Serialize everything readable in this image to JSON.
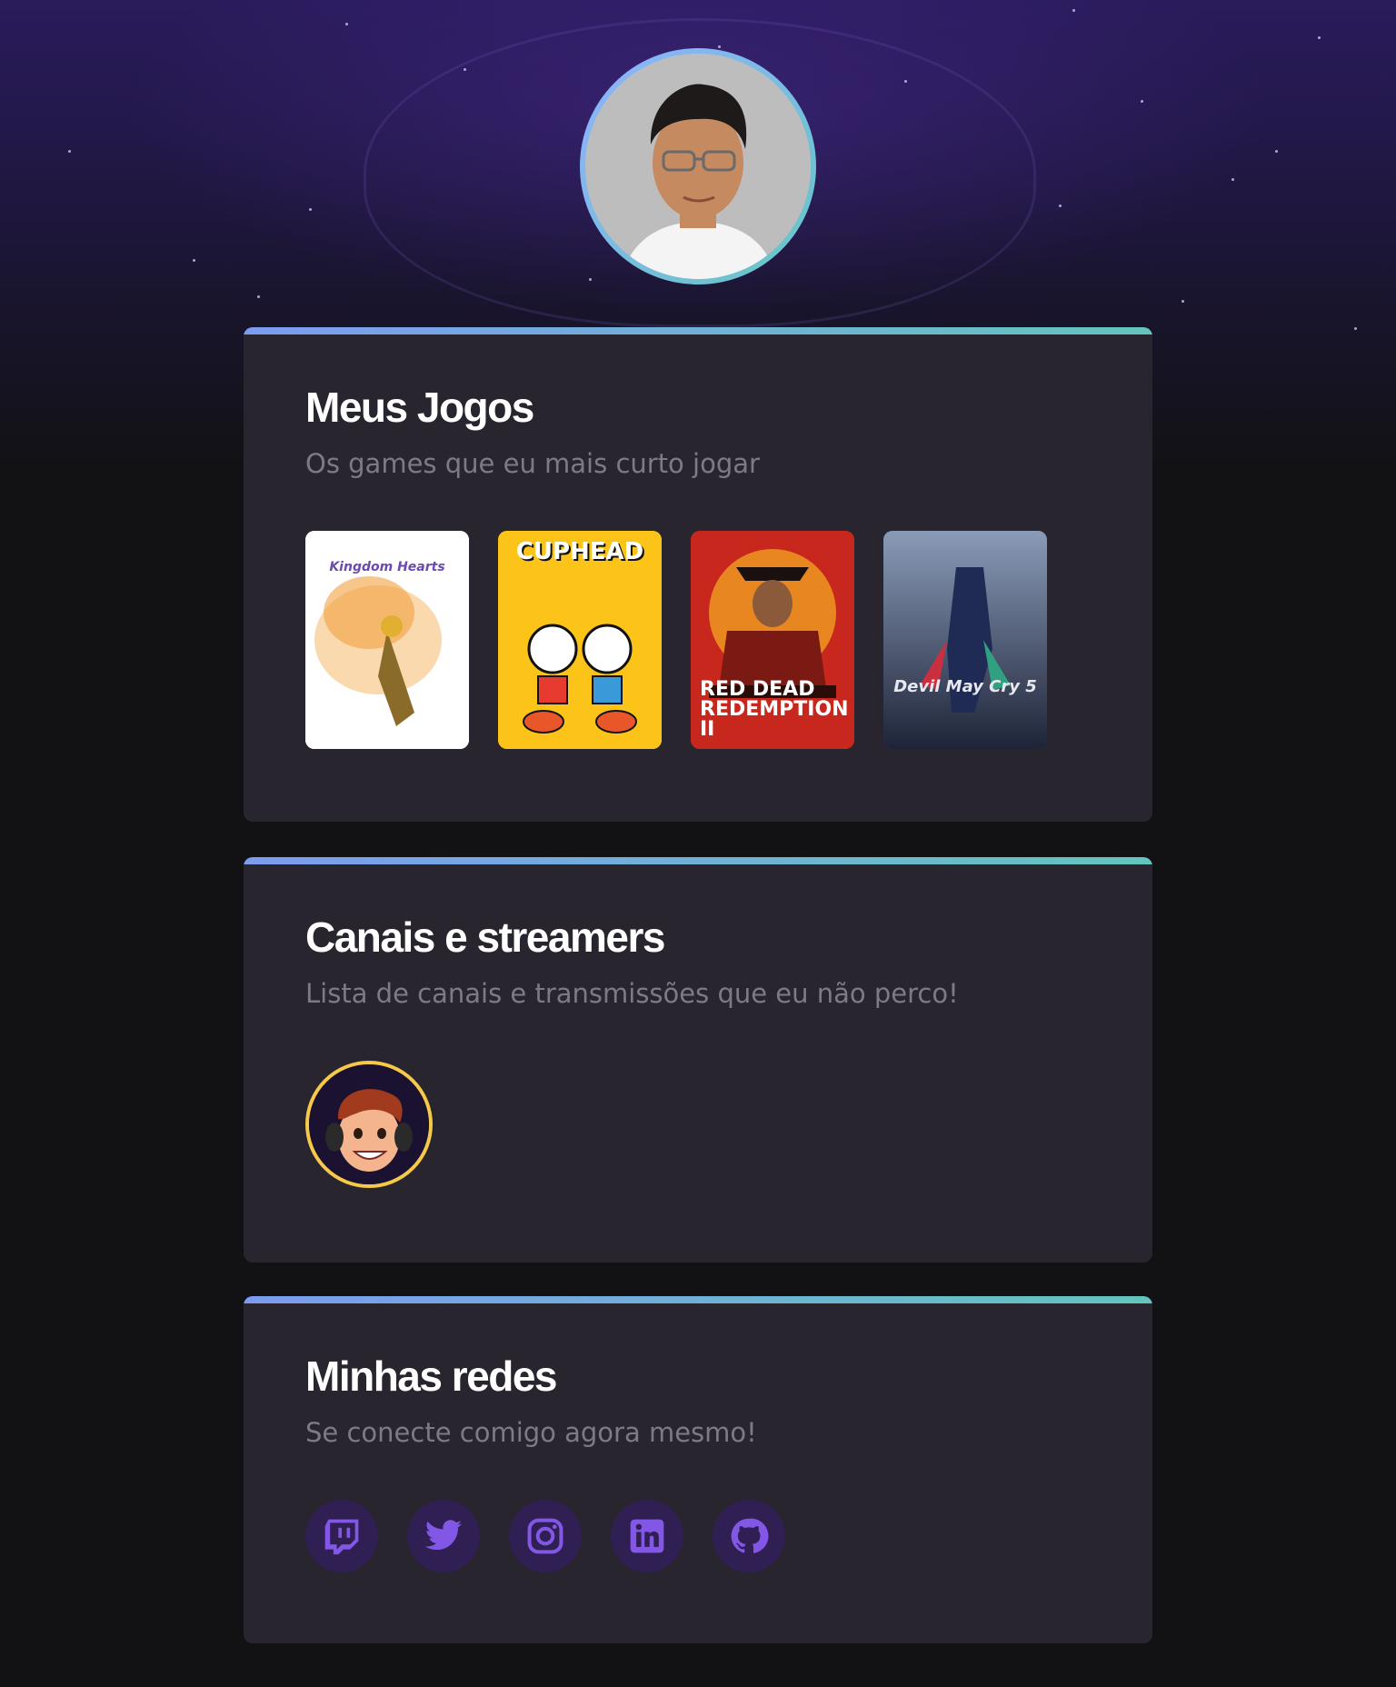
{
  "profile": {
    "avatar_icon": "profile-photo"
  },
  "games_section": {
    "title": "Meus Jogos",
    "subtitle": "Os games que eu mais curto jogar",
    "games": [
      {
        "name": "Kingdom Hearts",
        "cover_label": "Kingdom Hearts",
        "bg": "#ffffff",
        "color": "#6a4ab0"
      },
      {
        "name": "Cuphead",
        "cover_label": "CUPHEAD",
        "bg": "#fcc419",
        "color": "#ffffff"
      },
      {
        "name": "Red Dead Redemption II",
        "cover_label": "RED DEAD REDEMPTION II",
        "bg": "#c8271e",
        "color": "#ffffff"
      },
      {
        "name": "Devil May Cry 5",
        "cover_label": "Devil May Cry 5",
        "bg": "#3b4a6e",
        "color": "#e8e8f0"
      }
    ]
  },
  "streamers_section": {
    "title": "Canais e streamers",
    "subtitle": "Lista de canais e transmissões que eu não perco!"
  },
  "socials_section": {
    "title": "Minhas redes",
    "subtitle": "Se conecte comigo agora mesmo!",
    "icons": [
      "twitch-icon",
      "twitter-icon",
      "instagram-icon",
      "linkedin-icon",
      "github-icon"
    ],
    "icon_color": "#8257e5",
    "icon_bg": "#2f1f53"
  },
  "colors": {
    "card_bg": "#29252f",
    "accent_start": "#7c9cf0",
    "accent_end": "#63c5bd",
    "streamer_border": "#f7c948"
  }
}
